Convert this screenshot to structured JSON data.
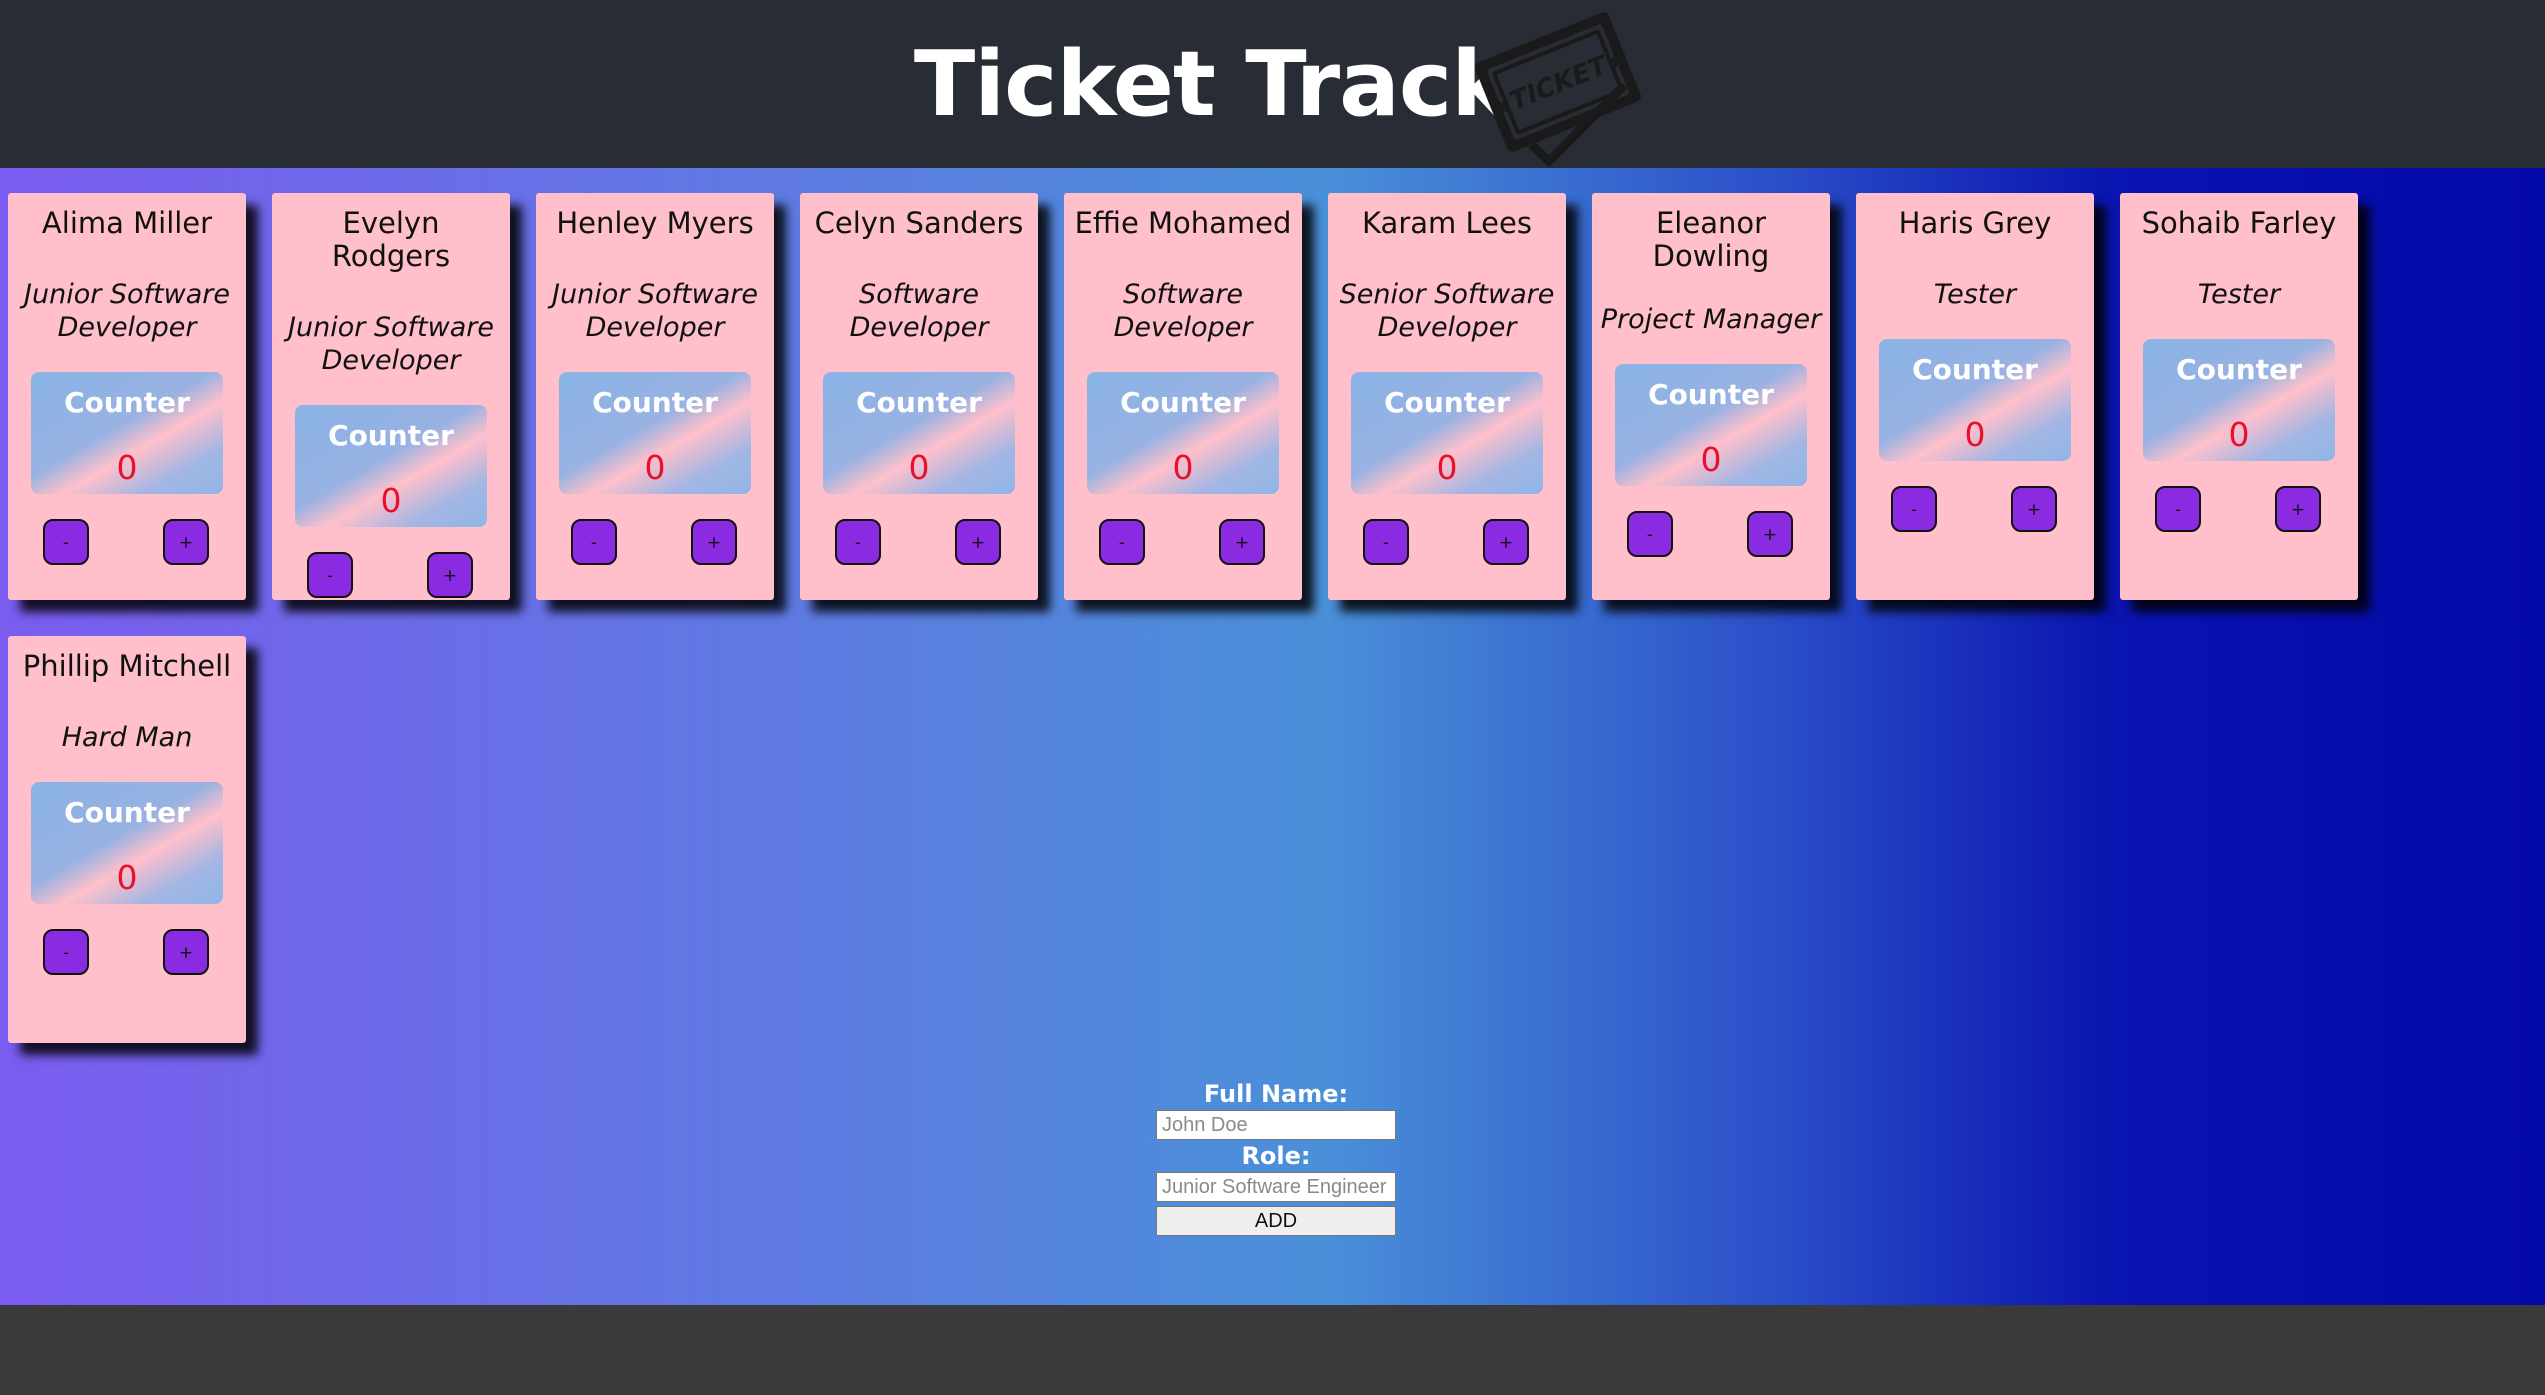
{
  "header": {
    "title": "Ticket Tracker",
    "logo_icon": "ticket-stamp-icon"
  },
  "colors": {
    "header_bg": "#282c34",
    "card_bg": "#ffc0cb",
    "counter_value": "#e8102a",
    "button_bg": "#8a2be2"
  },
  "cards": [
    {
      "name": "Alima Miller",
      "role": "Junior Software Developer",
      "counter_label": "Counter",
      "count": "0",
      "minus": "-",
      "plus": "+"
    },
    {
      "name": "Evelyn Rodgers",
      "role": "Junior Software Developer",
      "counter_label": "Counter",
      "count": "0",
      "minus": "-",
      "plus": "+"
    },
    {
      "name": "Henley Myers",
      "role": "Junior Software Developer",
      "counter_label": "Counter",
      "count": "0",
      "minus": "-",
      "plus": "+"
    },
    {
      "name": "Celyn Sanders",
      "role": "Software Developer",
      "counter_label": "Counter",
      "count": "0",
      "minus": "-",
      "plus": "+"
    },
    {
      "name": "Effie Mohamed",
      "role": "Software Developer",
      "counter_label": "Counter",
      "count": "0",
      "minus": "-",
      "plus": "+"
    },
    {
      "name": "Karam Lees",
      "role": "Senior Software Developer",
      "counter_label": "Counter",
      "count": "0",
      "minus": "-",
      "plus": "+"
    },
    {
      "name": "Eleanor Dowling",
      "role": "Project Manager",
      "counter_label": "Counter",
      "count": "0",
      "minus": "-",
      "plus": "+"
    },
    {
      "name": "Haris Grey",
      "role": "Tester",
      "counter_label": "Counter",
      "count": "0",
      "minus": "-",
      "plus": "+"
    },
    {
      "name": "Sohaib Farley",
      "role": "Tester",
      "counter_label": "Counter",
      "count": "0",
      "minus": "-",
      "plus": "+"
    },
    {
      "name": "Phillip Mitchell",
      "role": "Hard Man",
      "counter_label": "Counter",
      "count": "0",
      "minus": "-",
      "plus": "+"
    }
  ],
  "form": {
    "name_label": "Full Name:",
    "name_placeholder": "John Doe",
    "role_label": "Role:",
    "role_placeholder": "Junior Software Engineer",
    "add_label": "ADD"
  }
}
